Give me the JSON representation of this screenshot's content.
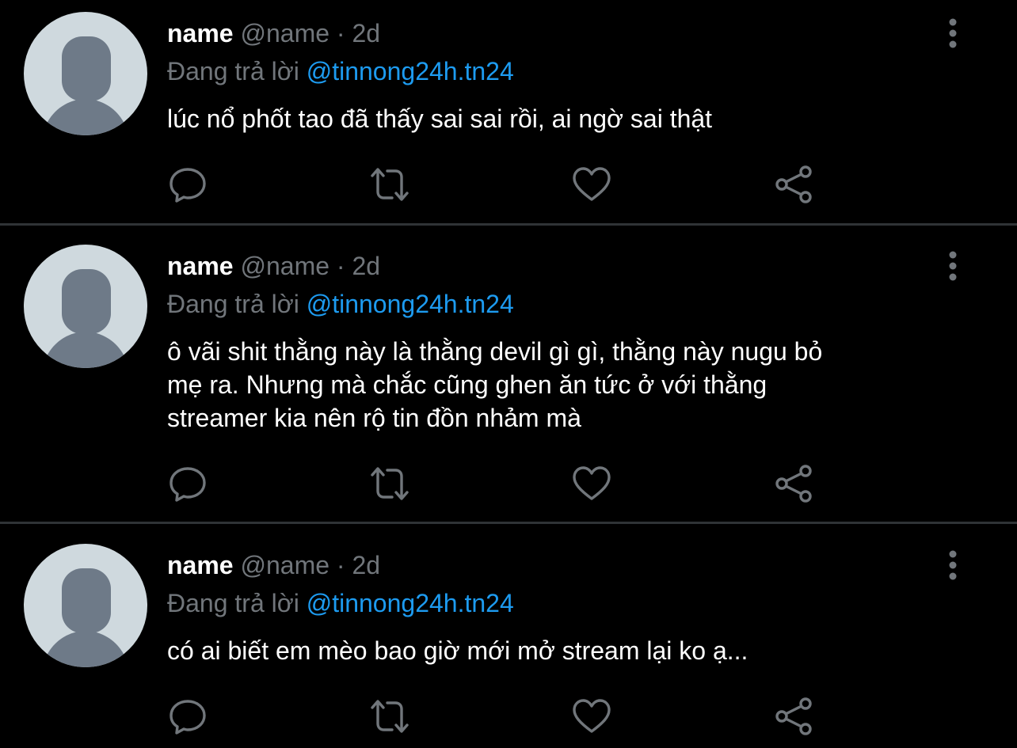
{
  "colors": {
    "background": "#000000",
    "primary_text": "#ffffff",
    "secondary_text": "#71767b",
    "mention": "#1d9bf0",
    "divider": "#2f3336",
    "avatar_bg": "#cfd9de",
    "avatar_figure": "#6e7a88",
    "icon": "#71767b"
  },
  "tweets": [
    {
      "display_name": "name",
      "handle": "@name",
      "separator": "·",
      "time": "2d",
      "reply_prefix": "Đang trả lời",
      "reply_to": "@tinnong24h.tn24",
      "text": "lúc nổ phốt tao đã thấy sai sai rồi, ai ngờ sai thật",
      "icons": [
        "reply-icon",
        "retweet-icon",
        "like-icon",
        "share-icon",
        "more-icon"
      ]
    },
    {
      "display_name": "name",
      "handle": "@name",
      "separator": "·",
      "time": "2d",
      "reply_prefix": "Đang trả lời",
      "reply_to": "@tinnong24h.tn24",
      "text_lines": [
        "ô vãi shit thằng này là thằng devil gì gì, thằng này nugu bỏ",
        "mẹ ra. Nhưng mà chắc cũng ghen ăn tức ở với thằng",
        "streamer kia nên rộ tin đồn nhảm mà"
      ],
      "icons": [
        "reply-icon",
        "retweet-icon",
        "like-icon",
        "share-icon",
        "more-icon"
      ]
    },
    {
      "display_name": "name",
      "handle": "@name",
      "separator": "·",
      "time": "2d",
      "reply_prefix": "Đang trả lời",
      "reply_to": "@tinnong24h.tn24",
      "text": "có ai biết em mèo bao giờ mới mở stream lại ko ạ...",
      "icons": [
        "reply-icon",
        "retweet-icon",
        "like-icon",
        "share-icon",
        "more-icon"
      ]
    }
  ]
}
